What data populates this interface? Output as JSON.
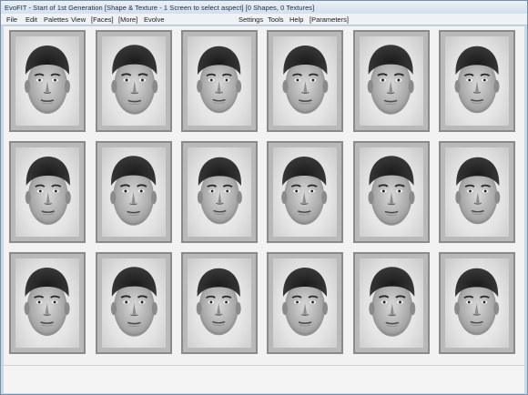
{
  "window": {
    "title": "EvoFIT - Start of 1st Generation [Shape & Texture - 1 Screen to select aspect] [0 Shapes, 0 Textures]"
  },
  "menubar": {
    "left_items": [
      "File",
      "Edit",
      "Palettes",
      "View",
      "[Faces]",
      "[More]",
      "Evolve"
    ],
    "right_items": [
      "Settings",
      "Tools",
      "Help",
      "[Parameters]"
    ]
  },
  "faces": {
    "rows": 3,
    "columns": 6,
    "count": 18,
    "selected_count": 0
  }
}
